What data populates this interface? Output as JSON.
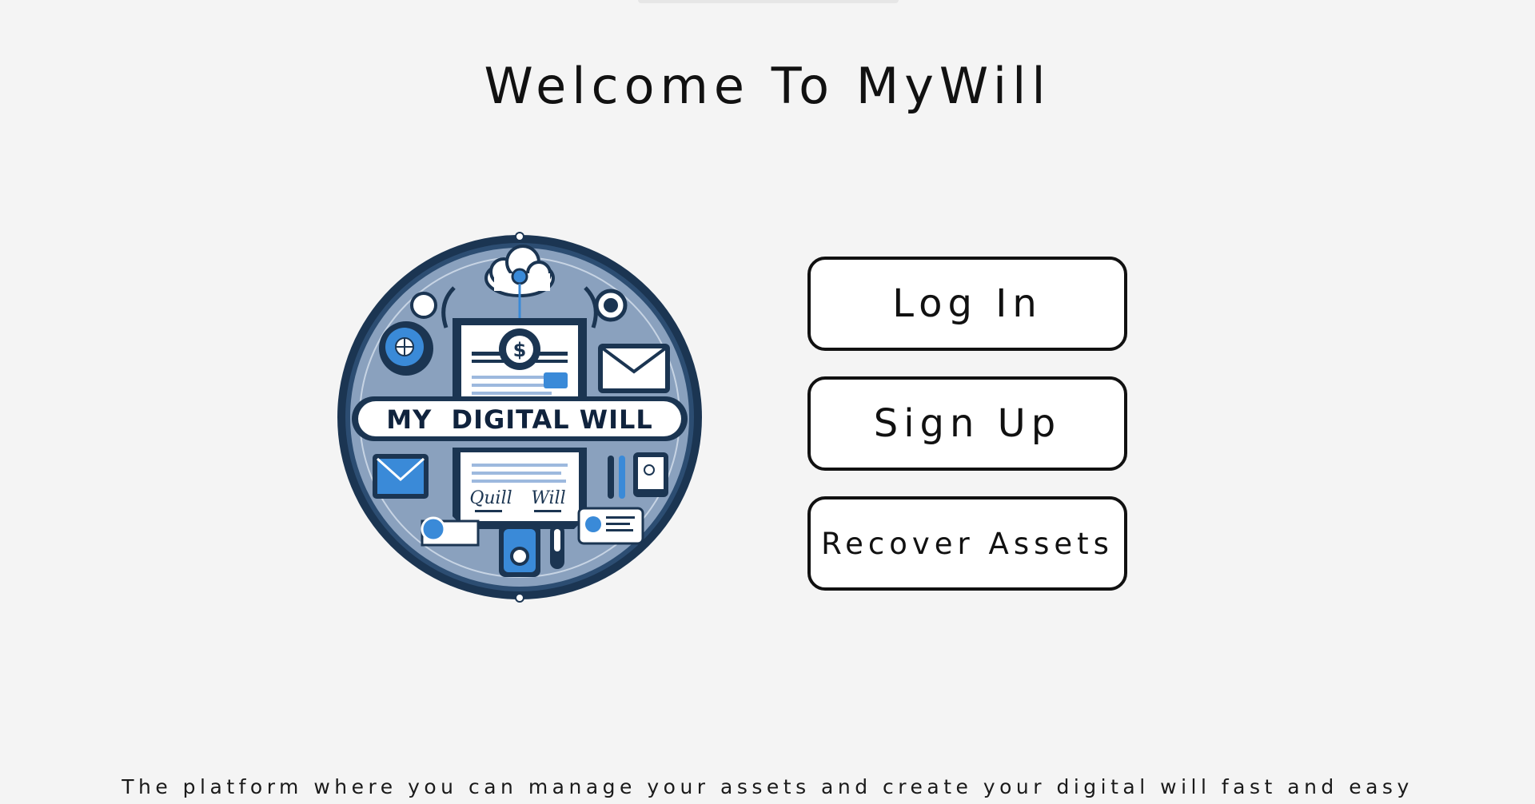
{
  "header": {
    "title": "Welcome To MyWill"
  },
  "logo": {
    "banner_text": "MY  DIGITAL WILL",
    "signature_left": "Quill",
    "signature_right": "Will",
    "center_symbol": "$",
    "colors": {
      "ring": "#1b3552",
      "inner": "#7f98b7",
      "accent": "#3a8ad8",
      "paper": "#ffffff"
    }
  },
  "actions": {
    "login_label": "Log In",
    "signup_label": "Sign Up",
    "recover_label": "Recover Assets"
  },
  "footer": {
    "tagline": "The platform where you can manage your assets and create your digital will fast and easy"
  }
}
